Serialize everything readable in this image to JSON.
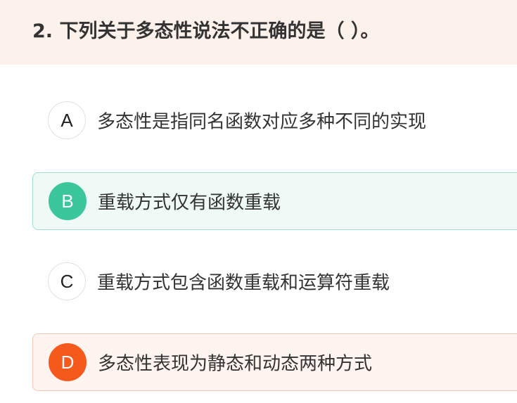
{
  "question": {
    "title": "2. 下列关于多态性说法不正确的是（ ）。"
  },
  "options": [
    {
      "letter": "A",
      "text": "多态性是指同名函数对应多种不同的实现",
      "state": "default"
    },
    {
      "letter": "B",
      "text": "重载方式仅有函数重载",
      "state": "correct"
    },
    {
      "letter": "C",
      "text": "重载方式包含函数重载和运算符重载",
      "state": "default"
    },
    {
      "letter": "D",
      "text": "多态性表现为静态和动态两种方式",
      "state": "selected-wrong"
    }
  ],
  "colors": {
    "header_bg": "#fdf1ec",
    "correct_accent": "#3cc69b",
    "correct_bg": "#effaf6",
    "wrong_accent": "#f5591c",
    "wrong_bg": "#fff4ef",
    "text": "#333333"
  }
}
